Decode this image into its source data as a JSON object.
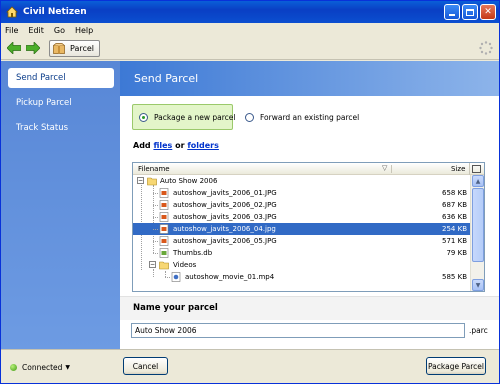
{
  "window": {
    "title": "Civil Netizen"
  },
  "menu": [
    "File",
    "Edit",
    "Go",
    "Help"
  ],
  "toolbar": {
    "breadcrumb": "Parcel"
  },
  "sidebar": {
    "items": [
      "Send Parcel",
      "Pickup Parcel",
      "Track Status"
    ],
    "active_index": 0
  },
  "main": {
    "header": "Send Parcel",
    "options": {
      "new_label": "Package a new parcel",
      "forward_label": "Forward an existing parcel",
      "selected": "new"
    },
    "add": {
      "prefix": "Add ",
      "files_link": "files",
      "middle": " or ",
      "folders_link": "folders"
    },
    "filelist": {
      "columns": {
        "name": "Filename",
        "size": "Size"
      },
      "rows": [
        {
          "name": "Auto Show 2006",
          "size": "",
          "type": "folder"
        },
        {
          "name": "autoshow_javits_2006_01.JPG",
          "size": "658 KB",
          "type": "image"
        },
        {
          "name": "autoshow_javits_2006_02.JPG",
          "size": "687 KB",
          "type": "image"
        },
        {
          "name": "autoshow_javits_2006_03.JPG",
          "size": "636 KB",
          "type": "image"
        },
        {
          "name": "autoshow_javits_2006_04.jpg",
          "size": "254 KB",
          "type": "image",
          "selected": true
        },
        {
          "name": "autoshow_javits_2006_05.JPG",
          "size": "571 KB",
          "type": "image"
        },
        {
          "name": "Thumbs.db",
          "size": "79 KB",
          "type": "db"
        },
        {
          "name": "Videos",
          "size": "",
          "type": "folder"
        },
        {
          "name": "autoshow_movie_01.mp4",
          "size": "585 KB",
          "type": "video"
        }
      ]
    },
    "parcel_name": {
      "label": "Name your parcel",
      "value": "Auto Show 2006",
      "extension": ".parc"
    }
  },
  "footer": {
    "status": "Connected",
    "cancel": "Cancel",
    "package": "Package Parcel"
  },
  "colors": {
    "title_bar": "#0a48d0",
    "sidebar": "#5e8edb",
    "selection": "#316ac5",
    "radio_box": "#e3f5c9"
  }
}
